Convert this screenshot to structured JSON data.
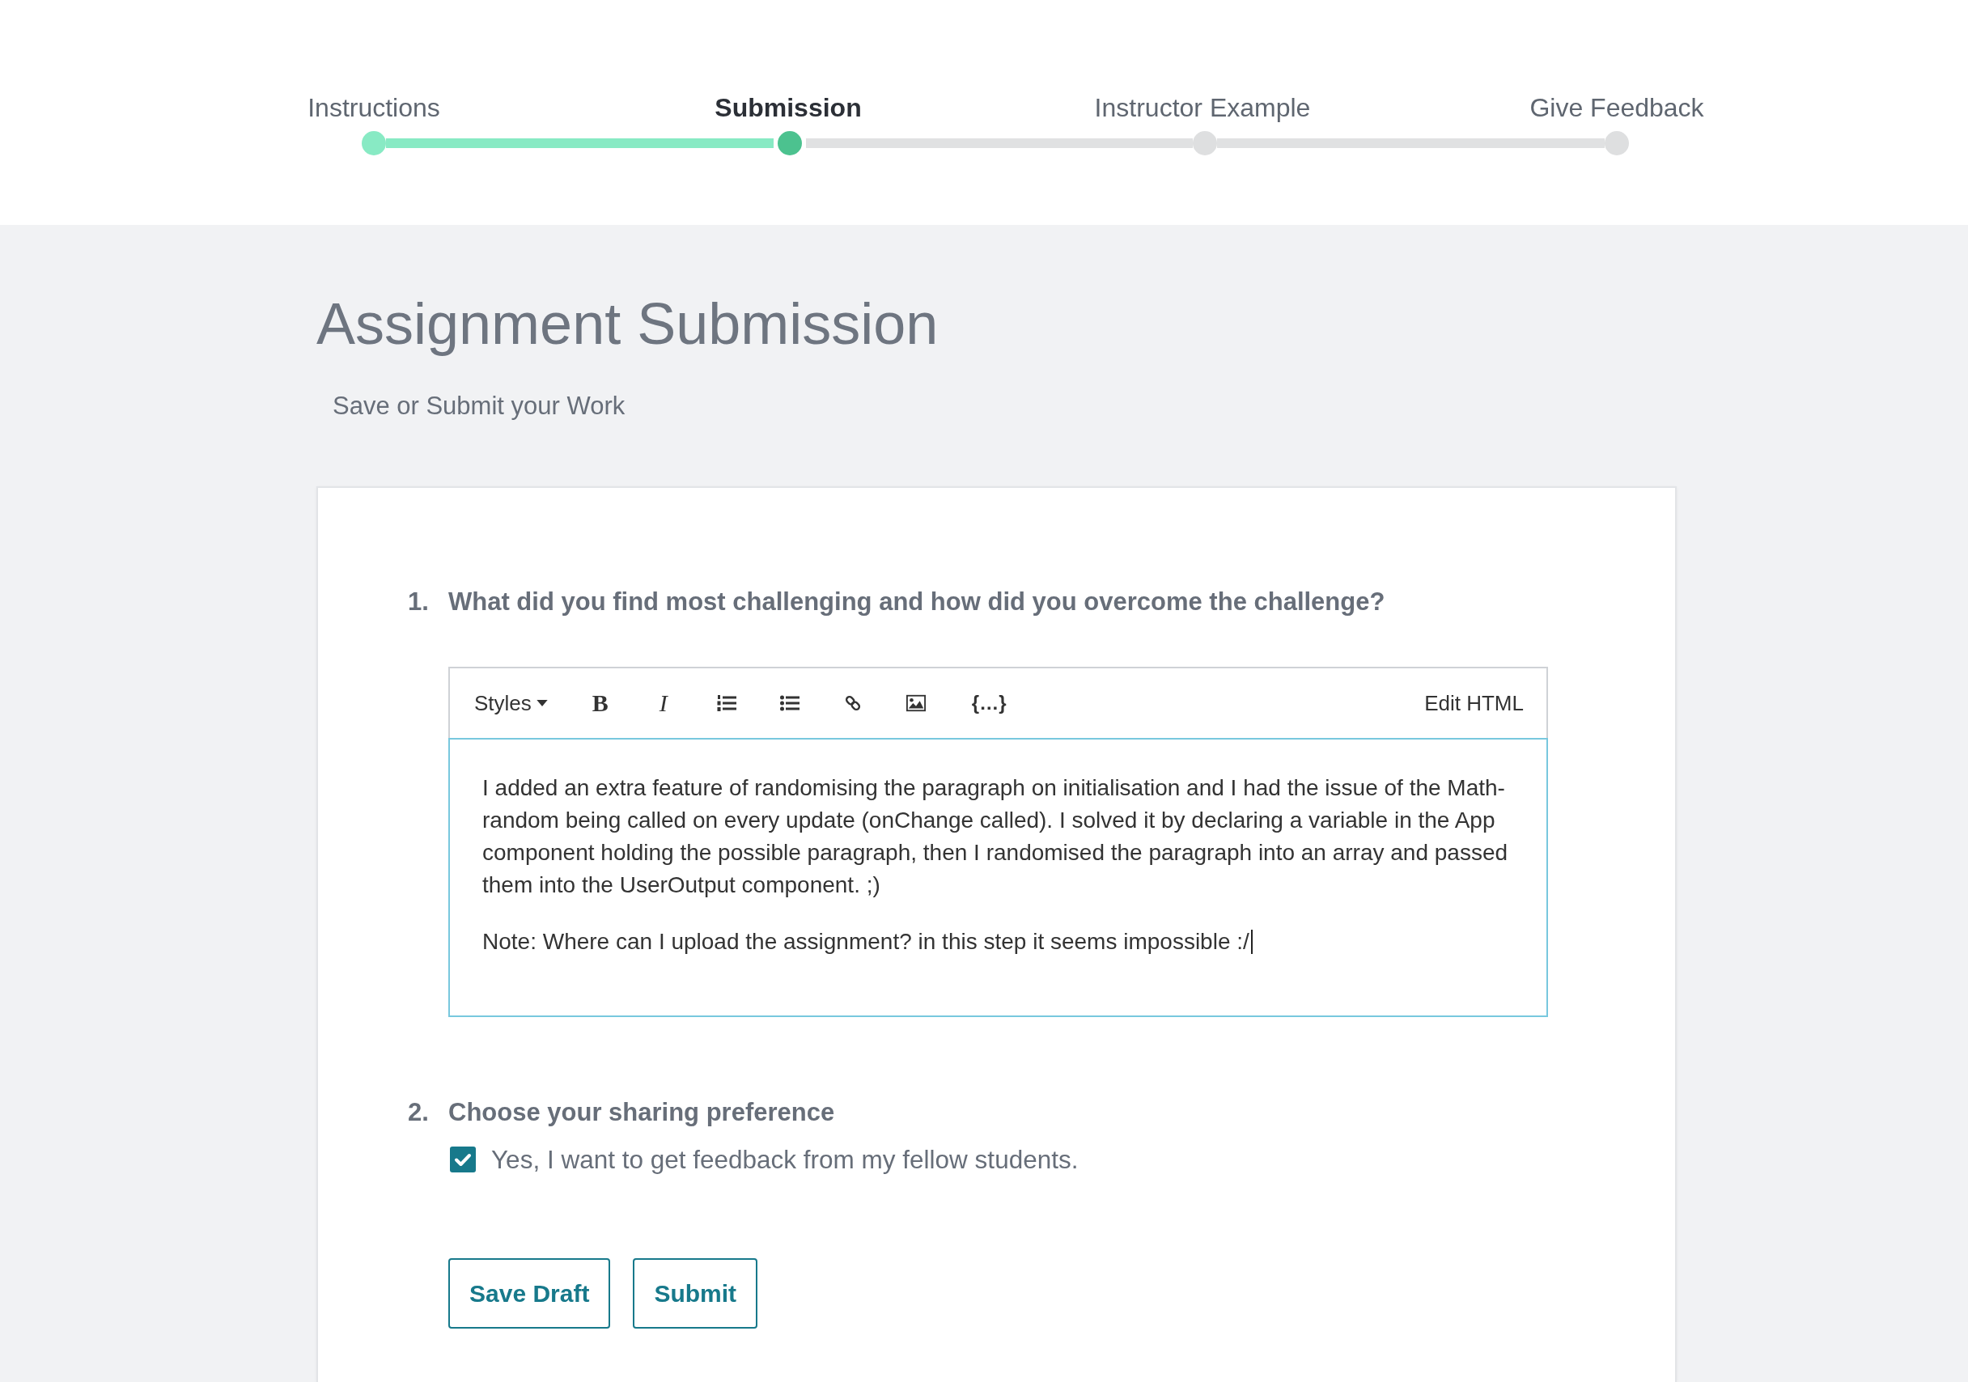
{
  "steps": [
    {
      "label": "Instructions",
      "completed": true,
      "selected": false
    },
    {
      "label": "Submission",
      "completed": false,
      "selected": true
    },
    {
      "label": "Instructor Example",
      "completed": false,
      "selected": false
    },
    {
      "label": "Give Feedback",
      "completed": false,
      "selected": false
    }
  ],
  "page": {
    "title": "Assignment Submission",
    "subtitle": "Save or Submit your Work"
  },
  "questions": [
    {
      "number": "1.",
      "text": "What did you find most challenging and how did you overcome the challenge?",
      "kind": "rich-text",
      "editor": {
        "toolbar": [
          {
            "kind": "dropdown",
            "label": "Styles"
          },
          {
            "kind": "bold",
            "label": "B"
          },
          {
            "kind": "italic",
            "label": "I"
          },
          {
            "kind": "numbered-list"
          },
          {
            "kind": "bulleted-list"
          },
          {
            "kind": "link"
          },
          {
            "kind": "image"
          },
          {
            "kind": "code",
            "label": "{…}"
          }
        ],
        "edit_html": "Edit HTML",
        "focused": true,
        "paragraphs": [
          "I added an extra feature of randomising the paragraph on initialisation and I had the issue of the Math-random being called on every update (onChange called). I solved it by declaring a variable in the App component holding the possible paragraph, then I randomised the paragraph into an array and passed them into the UserOutput component. ;)",
          "Note: Where can I upload the assignment? in this step it seems impossible :/"
        ]
      }
    },
    {
      "number": "2.",
      "text": "Choose your sharing preference",
      "kind": "checkbox",
      "option": {
        "label": "Yes, I want to get feedback from my fellow students.",
        "checked": true
      }
    }
  ],
  "buttons": [
    "Save Draft",
    "Submit"
  ]
}
